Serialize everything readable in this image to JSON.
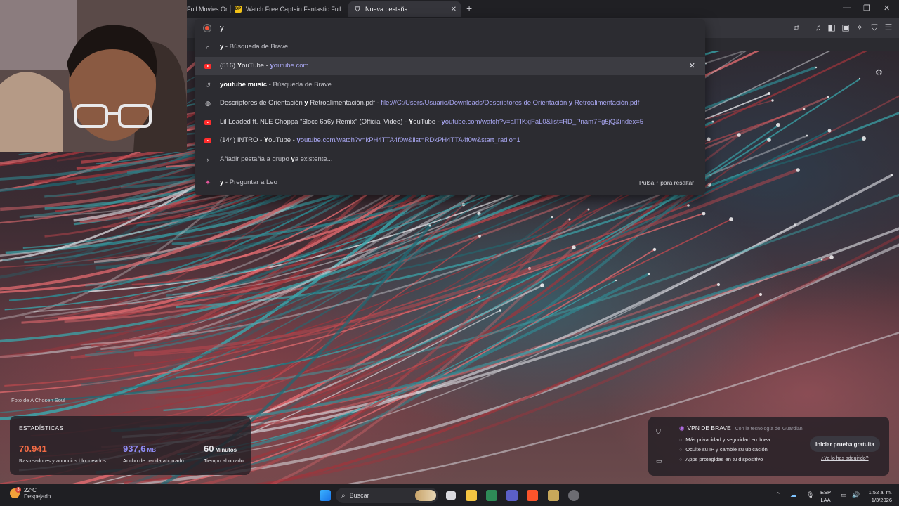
{
  "tabs": [
    {
      "title": "Full Movies On",
      "active": false
    },
    {
      "title": "Watch Free Captain Fantastic Full Mo",
      "active": false
    },
    {
      "title": "Nueva pestaña",
      "active": true
    }
  ],
  "omnibox": {
    "typed_text": "y",
    "suggestions": [
      {
        "icon": "search-icon",
        "bold": "y",
        "rest": " - Búsqueda de Brave",
        "url": "",
        "removable": false
      },
      {
        "icon": "youtube-icon",
        "pre": "(516) ",
        "bold": "Y",
        "rest": "ouTube - ",
        "url_bold": "y",
        "url": "outube.com",
        "removable": true
      },
      {
        "icon": "history-icon",
        "bold": "youtube music",
        "rest": " - Búsqueda de Brave",
        "url": "",
        "removable": false
      },
      {
        "icon": "globe-icon",
        "text": "Descriptores de Orientación ",
        "bold": "y",
        "rest": " Retroalimentación.pdf - ",
        "url": "file:///C:/Users/Usuario/Downloads/Descriptores de Orientación ",
        "url_bold": "y",
        "url_tail": " Retroalimentación.pdf"
      },
      {
        "icon": "youtube-icon",
        "text": "Lil Loaded ft. NLE Choppa \"6locc 6a6y Remix\" (Official Video) - ",
        "bold": "Y",
        "rest": "ouTube - ",
        "url_bold": "y",
        "url": "outube.com/watch?v=aITIKxjFaL0&list=RD_Pnam7Fg5jQ&index=5"
      },
      {
        "icon": "youtube-icon",
        "text": "(144) INTRO - ",
        "bold": "Y",
        "rest": "ouTube - ",
        "url_bold": "y",
        "url": "outube.com/watch?v=kPH4TTA4f0w&list=RDkPH4TTA4f0w&start_radio=1"
      },
      {
        "icon": "chevron-right-icon",
        "text": "Añadir pestaña a grupo ",
        "bold": "y",
        "rest": "a existente..."
      },
      {
        "icon": "leo-icon",
        "bold": "y",
        "rest": " - Preguntar a Leo",
        "hint": "Pulsa ↑ para resaltar"
      }
    ]
  },
  "photo_credit": "Foto de A Chosen Soul",
  "stats": {
    "title": "ESTADÍSTICAS",
    "trackers": {
      "value": "70.941",
      "label": "Rastreadores y anuncios bloqueados",
      "color": "#f36b45"
    },
    "bandwidth": {
      "value": "937,6",
      "unit": "MB",
      "label": "Ancho de banda ahorrado",
      "color": "#8f8cf5"
    },
    "time": {
      "value": "60",
      "unit": "Minutos",
      "label": "Tiempo ahorrado",
      "color": "#ffffff"
    }
  },
  "vpn": {
    "title": "VPN DE BRAVE",
    "powered_by": "Con la tecnología de",
    "powered_brand": "Guardian",
    "features": [
      "Más privacidad y seguridad en línea",
      "Oculte su IP y cambie su ubicación",
      "Apps protegidas en tu dispositivo"
    ],
    "trial_button": "Iniciar prueba gratuita",
    "acquired_link": "¿Ya lo has adquirido?"
  },
  "taskbar": {
    "weather_temp": "22°C",
    "weather_desc": "Despejado",
    "weather_badge": "3",
    "search_label": "Buscar",
    "lang_top": "ESP",
    "lang_bottom": "LAA",
    "time": "1:52 a. m.",
    "date": "1/3/2026"
  },
  "colors": {
    "accent_purple": "#a9a7f2",
    "youtube_red": "#ff2d2d",
    "brave_orange": "#f0533a"
  }
}
